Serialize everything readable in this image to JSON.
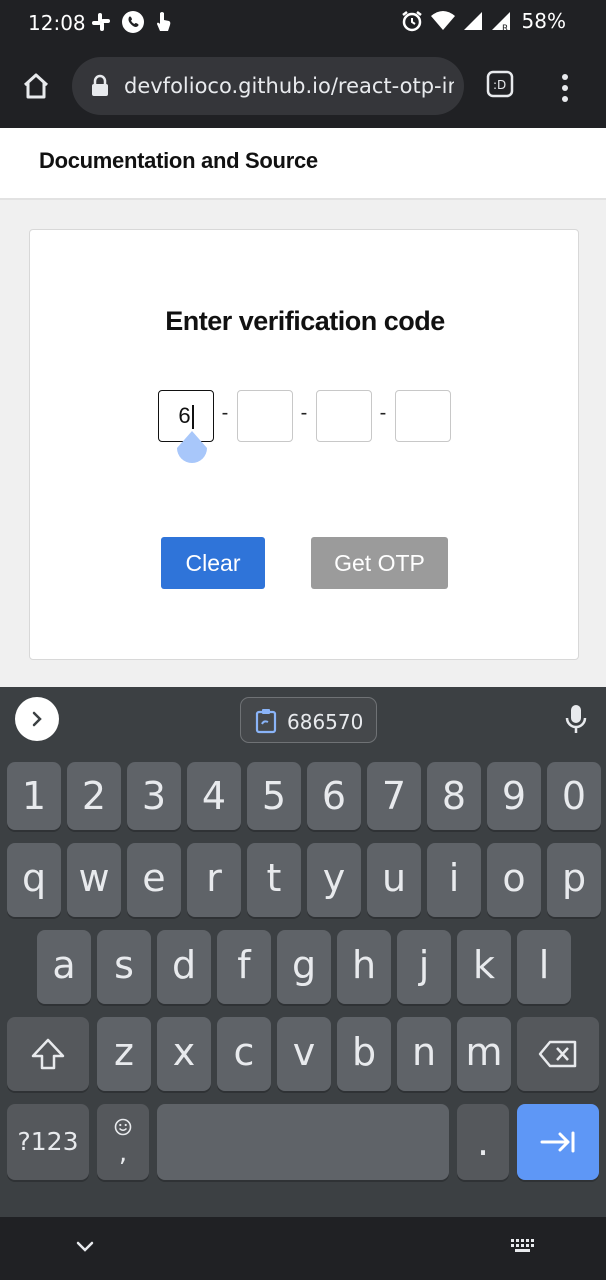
{
  "status_bar": {
    "time": "12:08",
    "battery": "58%",
    "icons_left": [
      "slack-icon",
      "whatsapp-icon",
      "touch-icon"
    ],
    "icons_right": [
      "alarm-icon",
      "wifi-icon",
      "signal-icon",
      "signal-roaming-icon"
    ]
  },
  "browser": {
    "url": "devfolioco.github.io/react-otp-input",
    "home_icon": "home-icon",
    "lock_icon": "lock-icon",
    "reader_icon": "reader-mode-icon",
    "menu_icon": "more-vert-icon"
  },
  "page": {
    "header_link": "Documentation and Source",
    "title": "Enter verification code",
    "otp_values": [
      "6",
      "",
      "",
      ""
    ],
    "separator": "-",
    "clear_label": "Clear",
    "get_otp_label": "Get OTP",
    "colors": {
      "clear_button": "#2f74d9",
      "get_otp_button": "#9b9b9b"
    }
  },
  "keyboard": {
    "clipboard_suggestion": "686570",
    "number_row": [
      "1",
      "2",
      "3",
      "4",
      "5",
      "6",
      "7",
      "8",
      "9",
      "0"
    ],
    "row1": [
      "q",
      "w",
      "e",
      "r",
      "t",
      "y",
      "u",
      "i",
      "o",
      "p"
    ],
    "row2": [
      "a",
      "s",
      "d",
      "f",
      "g",
      "h",
      "j",
      "k",
      "l"
    ],
    "row3": [
      "z",
      "x",
      "c",
      "v",
      "b",
      "n",
      "m"
    ],
    "symbols_key": "?123",
    "comma_key": ",",
    "period_key": ".",
    "enter_color": "#5e97f6"
  }
}
